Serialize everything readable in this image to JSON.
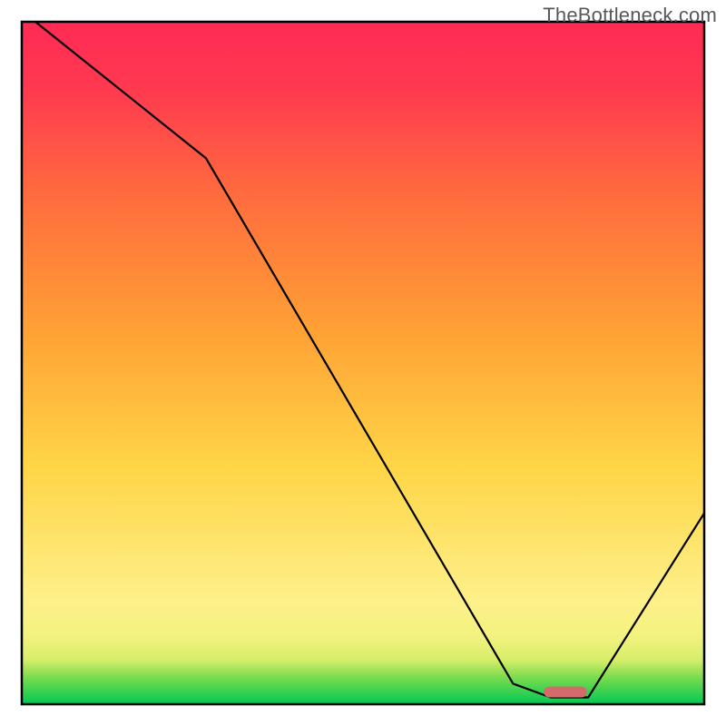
{
  "watermark": "TheBottleneck.com",
  "chart_data": {
    "type": "line",
    "title": "",
    "xlabel": "",
    "ylabel": "",
    "xlim": [
      0,
      100
    ],
    "ylim": [
      0,
      100
    ],
    "grid": false,
    "series": [
      {
        "name": "curve",
        "x": [
          2,
          27,
          72,
          77.5,
          83,
          100
        ],
        "y": [
          100,
          80,
          3,
          1,
          1,
          28
        ],
        "stroke": "#000000",
        "width": 2.2
      }
    ],
    "markers": [
      {
        "name": "red-pill",
        "x_start": 76.5,
        "x_end": 82.8,
        "y": 1.8,
        "height_pct": 1.6,
        "fill": "#d46a6a",
        "rx_pct": 0.8
      }
    ],
    "background_gradient": {
      "bands": [
        {
          "pct": 0.0,
          "color": "#00c853"
        },
        {
          "pct": 4.0,
          "color": "#7ddc4e"
        },
        {
          "pct": 6.5,
          "color": "#d7ee6a"
        },
        {
          "pct": 10.0,
          "color": "#f3f27f"
        },
        {
          "pct": 15.0,
          "color": "#fdf08a"
        },
        {
          "pct": 35.0,
          "color": "#ffd546"
        },
        {
          "pct": 55.0,
          "color": "#ffa035"
        },
        {
          "pct": 75.0,
          "color": "#ff6a3e"
        },
        {
          "pct": 90.0,
          "color": "#ff3a4f"
        },
        {
          "pct": 100.0,
          "color": "#ff2a55"
        }
      ]
    },
    "frame_inset_pct": 3.0
  }
}
